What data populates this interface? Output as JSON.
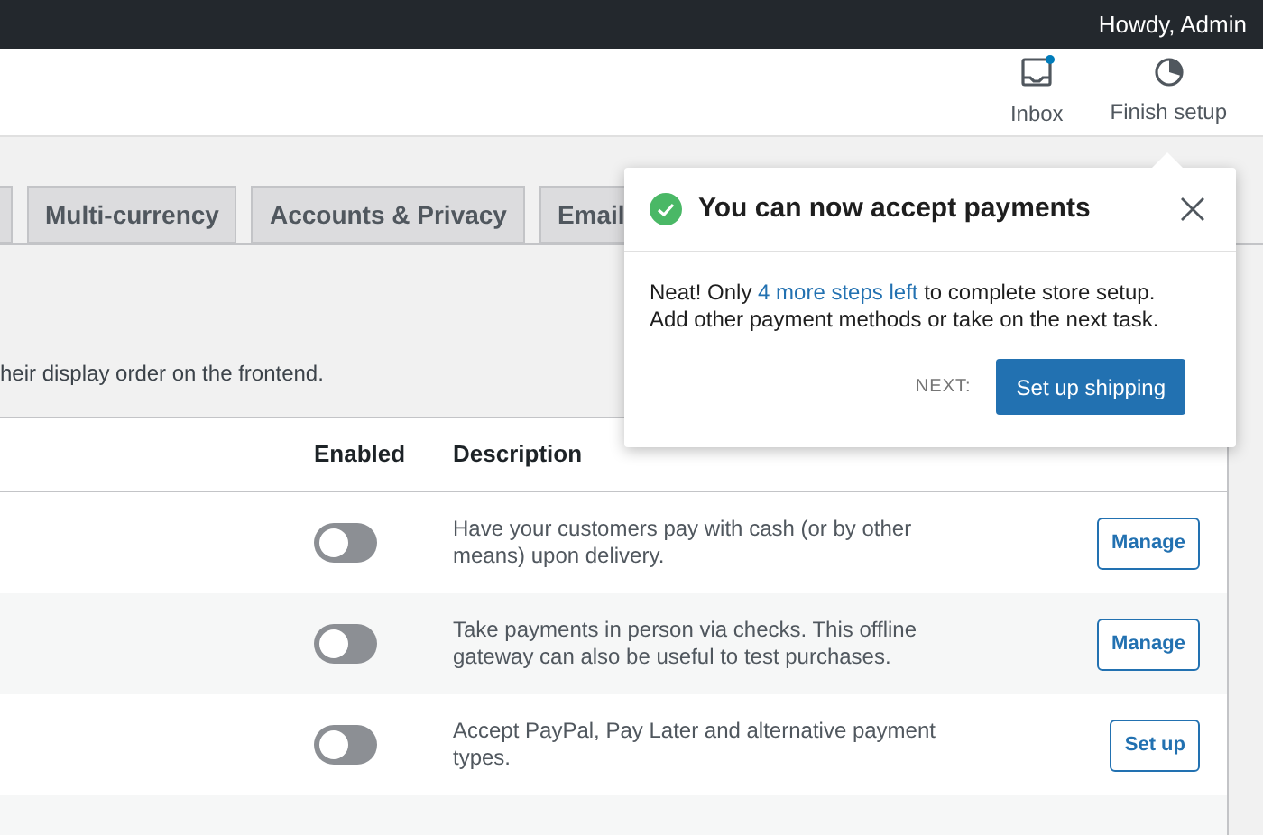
{
  "admin_bar": {
    "greeting": "Howdy, Admin"
  },
  "header": {
    "actions": [
      {
        "label": "Inbox",
        "kind": "inbox",
        "unread": true
      },
      {
        "label": "Finish setup",
        "kind": "progress"
      }
    ]
  },
  "tabs": [
    {
      "label": "Multi-currency",
      "selected": false
    },
    {
      "label": "Accounts & Privacy",
      "selected": false
    },
    {
      "label": "Email",
      "selected": false
    }
  ],
  "intro": "heir display order on the frontend.",
  "table": {
    "columns": [
      "Enabled",
      "Description"
    ],
    "rows": [
      {
        "enabled": false,
        "description": "Have your customers pay with cash (or by other means) upon delivery.",
        "action": "Manage"
      },
      {
        "enabled": false,
        "description": "Take payments in person via checks. This offline gateway can also be useful to test purchases.",
        "action": "Manage"
      },
      {
        "enabled": false,
        "description": "Accept PayPal, Pay Later and alternative payment types.",
        "action": "Set up"
      }
    ]
  },
  "popover": {
    "title": "You can now accept payments",
    "body": {
      "before": "Neat! Only ",
      "link": "4 more steps left",
      "after": " to complete store setup. Add other payment methods or take on the next task."
    },
    "next_label": "NEXT:",
    "button": "Set up shipping"
  }
}
